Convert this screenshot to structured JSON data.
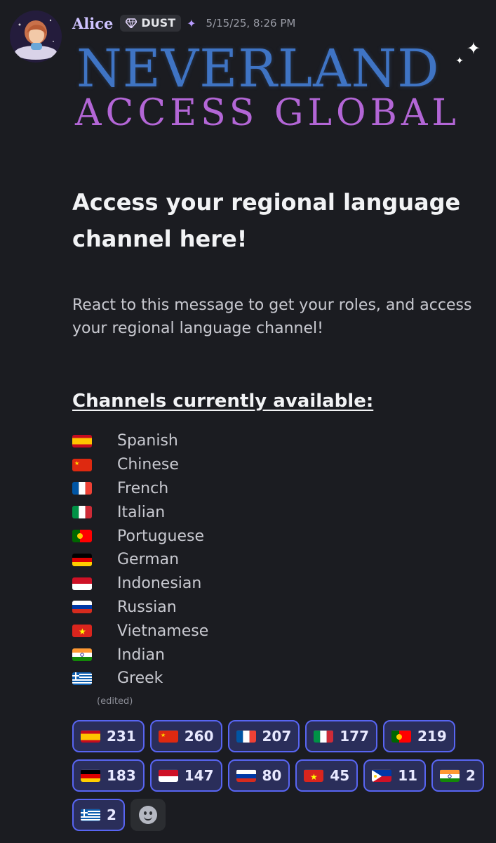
{
  "message": {
    "author": "Alice",
    "tag_label": "DUST",
    "timestamp": "5/15/25, 8:26 PM",
    "banner": {
      "line1": "NEVERLAND",
      "line2": "ACCESS GLOBAL"
    },
    "heading": "Access your regional language channel here!",
    "body": "React to this message to get your roles, and access your regional language channel!",
    "subheading": "Channels currently available:",
    "channels": [
      {
        "flag": "spain-flag-icon",
        "label": "Spanish"
      },
      {
        "flag": "china-flag-icon",
        "label": "Chinese"
      },
      {
        "flag": "france-flag-icon",
        "label": "French"
      },
      {
        "flag": "italy-flag-icon",
        "label": "Italian"
      },
      {
        "flag": "portugal-flag-icon",
        "label": "Portuguese"
      },
      {
        "flag": "germany-flag-icon",
        "label": "German"
      },
      {
        "flag": "indonesia-flag-icon",
        "label": "Indonesian"
      },
      {
        "flag": "russia-flag-icon",
        "label": "Russian"
      },
      {
        "flag": "vietnam-flag-icon",
        "label": "Vietnamese"
      },
      {
        "flag": "india-flag-icon",
        "label": "Indian"
      },
      {
        "flag": "greece-flag-icon",
        "label": "Greek"
      }
    ],
    "edited_label": "(edited)"
  },
  "reactions": [
    {
      "flag": "spain-flag-icon",
      "count": "231"
    },
    {
      "flag": "china-flag-icon",
      "count": "260"
    },
    {
      "flag": "france-flag-icon",
      "count": "207"
    },
    {
      "flag": "italy-flag-icon",
      "count": "177"
    },
    {
      "flag": "portugal-flag-icon",
      "count": "219"
    },
    {
      "flag": "germany-flag-icon",
      "count": "183"
    },
    {
      "flag": "indonesia-flag-icon",
      "count": "147"
    },
    {
      "flag": "russia-flag-icon",
      "count": "80"
    },
    {
      "flag": "vietnam-flag-icon",
      "count": "45"
    },
    {
      "flag": "philippines-flag-icon",
      "count": "11"
    },
    {
      "flag": "india-flag-icon",
      "count": "2"
    },
    {
      "flag": "greece-flag-icon",
      "count": "2"
    }
  ],
  "colors": {
    "accent": "#5865f2",
    "reaction_bg": "#2a2e5a",
    "username": "#cfc3ff",
    "banner_blue": "#3f74c4",
    "banner_purple": "#b366d6"
  }
}
